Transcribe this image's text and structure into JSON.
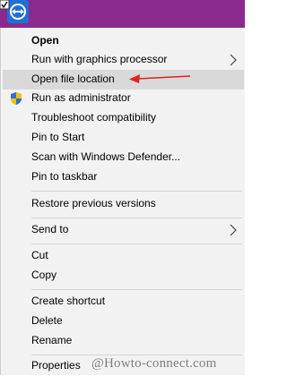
{
  "context_menu": {
    "items": [
      {
        "label": "Open",
        "bold": true
      },
      {
        "label": "Run with graphics processor",
        "submenu": true
      },
      {
        "label": "Open file location",
        "highlighted": true
      },
      {
        "label": "Run as administrator",
        "icon": "uac-shield-icon"
      },
      {
        "label": "Troubleshoot compatibility"
      },
      {
        "label": "Pin to Start"
      },
      {
        "label": "Scan with Windows Defender..."
      },
      {
        "label": "Pin to taskbar"
      },
      {
        "label": "Restore previous versions"
      },
      {
        "label": "Send to",
        "submenu": true
      },
      {
        "label": "Cut"
      },
      {
        "label": "Copy"
      },
      {
        "label": "Create shortcut"
      },
      {
        "label": "Delete"
      },
      {
        "label": "Rename"
      },
      {
        "label": "Properties"
      }
    ]
  },
  "annotation": {
    "arrow_color": "#e02020",
    "points_to": "Open file location"
  },
  "watermark": {
    "text": "@Howto-connect.com"
  },
  "colors": {
    "taskbar": "#8a2a8e",
    "menu_bg": "#f2f2f2",
    "hover": "#d9d9d9"
  }
}
